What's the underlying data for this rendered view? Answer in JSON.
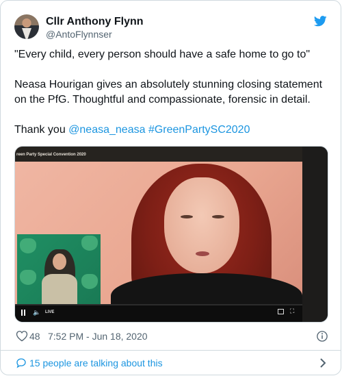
{
  "author": {
    "name": "Cllr Anthony Flynn",
    "handle": "@AntoFlynnser"
  },
  "tweet": {
    "quote": "\"Every child, every person should have a safe home to go to\"",
    "body": "Neasa Hourigan gives an absolutely stunning closing statement on the PfG. Thoughtful and compassionate, forensic in detail.",
    "thanks_prefix": "Thank you ",
    "mention": "@neasa_neasa",
    "hashtag": "#GreenPartySC2020"
  },
  "media": {
    "screen_title": "reen Party Special Convention 2020",
    "live_label": "LIVE"
  },
  "footer": {
    "like_count": "48",
    "timestamp": "7:52 PM - Jun 18, 2020",
    "conversation": "15 people are talking about this"
  },
  "colors": {
    "link": "#1b95e0",
    "secondary_text": "#536471",
    "twitter_blue": "#1d9bf0",
    "border": "#cfd9de"
  },
  "icons": [
    "twitter-bird-icon",
    "heart-icon",
    "info-icon",
    "speech-bubble-icon",
    "chevron-right-icon",
    "pause-icon",
    "volume-icon",
    "pip-icon",
    "fullscreen-icon"
  ]
}
